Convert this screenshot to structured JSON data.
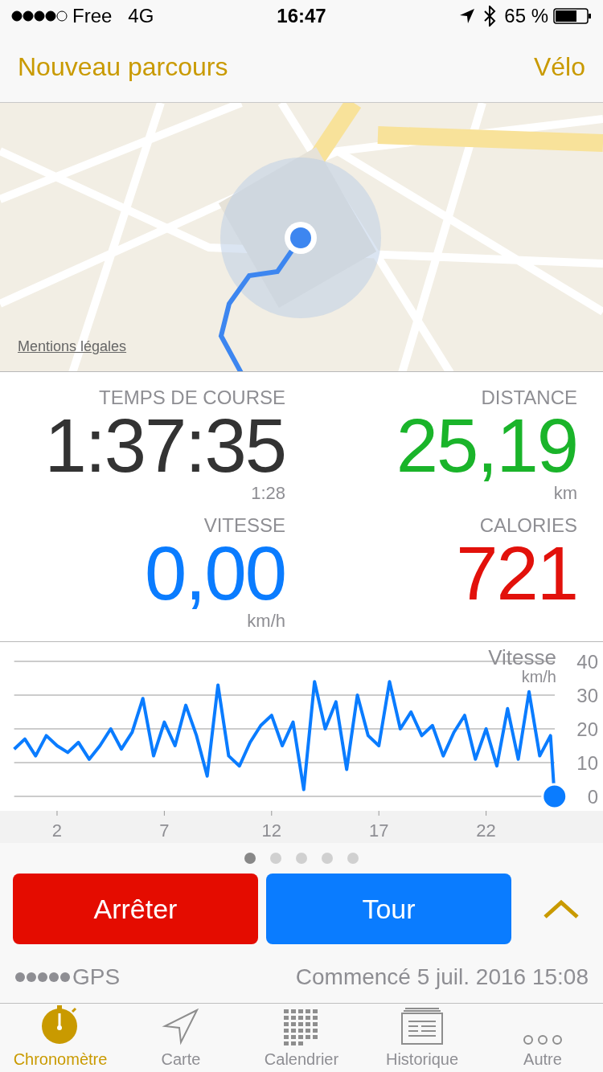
{
  "status_bar": {
    "carrier": "Free",
    "network": "4G",
    "time": "16:47",
    "battery": "65 %"
  },
  "nav": {
    "left": "Nouveau parcours",
    "right": "Vélo"
  },
  "map": {
    "kind": "picture",
    "legal": "Mentions légales"
  },
  "stats": [
    {
      "label": "TEMPS DE COURSE",
      "value": "1:37:35",
      "sub": "1:28",
      "color": "#333333"
    },
    {
      "label": "DISTANCE",
      "value": "25,19",
      "sub": "km",
      "color": "#1ab42a"
    },
    {
      "label": "VITESSE",
      "value": "0,00",
      "sub": "km/h",
      "color": "#0a7cff"
    },
    {
      "label": "CALORIES",
      "value": "721",
      "color": "#e2110b"
    }
  ],
  "chart": {
    "chart_data": {
      "type": "line",
      "title": "Vitesse",
      "ylabel": "km/h",
      "grid": true,
      "xlim": [
        0,
        25.2
      ],
      "ylim": [
        0,
        40
      ],
      "xticks": [
        2,
        7,
        12,
        17,
        22
      ],
      "yticks": [
        0,
        10,
        20,
        30,
        40
      ],
      "x": [
        0,
        0.5,
        1,
        1.5,
        2,
        2.5,
        3,
        3.5,
        4,
        4.5,
        5,
        5.5,
        6,
        6.5,
        7,
        7.5,
        8,
        8.5,
        9,
        9.5,
        10,
        10.5,
        11,
        11.5,
        12,
        12.5,
        13,
        13.5,
        14,
        14.5,
        15,
        15.5,
        16,
        16.5,
        17,
        17.5,
        18,
        18.5,
        19,
        19.5,
        20,
        20.5,
        21,
        21.5,
        22,
        22.5,
        23,
        23.5,
        24,
        24.5,
        25,
        25.19
      ],
      "series": [
        {
          "color": "#0a7cff",
          "values": [
            14,
            17,
            12,
            18,
            15,
            13,
            16,
            11,
            15,
            20,
            14,
            19,
            29,
            12,
            22,
            15,
            27,
            18,
            6,
            33,
            12,
            9,
            16,
            21,
            24,
            15,
            22,
            2,
            34,
            20,
            28,
            8,
            30,
            18,
            15,
            34,
            20,
            25,
            18,
            21,
            12,
            19,
            24,
            11,
            20,
            9,
            26,
            11,
            31,
            12,
            18,
            0
          ]
        }
      ]
    }
  },
  "pages": [
    {
      "selected": true
    },
    {
      "selected": false
    },
    {
      "selected": false
    },
    {
      "selected": false
    },
    {
      "selected": false
    }
  ],
  "actions": [
    {
      "label": "Arrêter",
      "kind": "stop"
    },
    {
      "label": "Tour",
      "kind": "lap"
    }
  ],
  "gps": {
    "label": "GPS"
  },
  "started": "Commencé 5 juil. 2016 15:08",
  "tabs": [
    {
      "label": "Chronomètre",
      "selected": true
    },
    {
      "label": "Carte",
      "selected": false
    },
    {
      "label": "Calendrier",
      "selected": false
    },
    {
      "label": "Historique",
      "selected": false
    },
    {
      "label": "Autre",
      "selected": false
    }
  ]
}
